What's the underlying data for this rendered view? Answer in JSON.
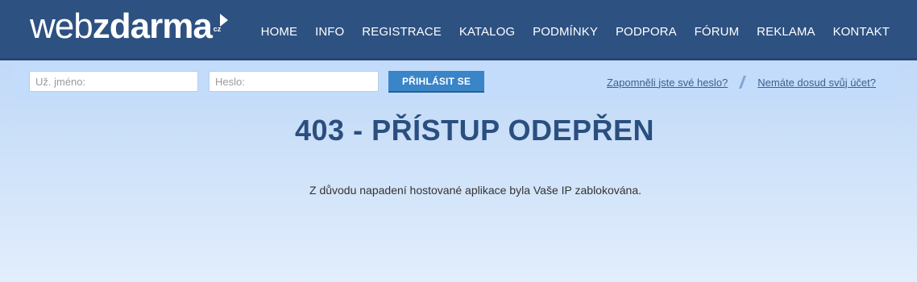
{
  "logo": {
    "web": "web",
    "zdarma": "zdarma",
    "cz": "cz"
  },
  "nav": {
    "home": "HOME",
    "info": "INFO",
    "registrace": "REGISTRACE",
    "katalog": "KATALOG",
    "podminky": "PODMÍNKY",
    "podpora": "PODPORA",
    "forum": "FÓRUM",
    "reklama": "REKLAMA",
    "kontakt": "KONTAKT"
  },
  "login": {
    "username_placeholder": "Už. jméno:",
    "password_placeholder": "Heslo:",
    "submit_label": "PŘIHLÁSIT SE",
    "forgot_link": "Zapomněli jste své heslo?",
    "no_account_link": "Nemáte dosud svůj účet?"
  },
  "main": {
    "title": "403 - PŘÍSTUP ODEPŘEN",
    "message": "Z důvodu napadení hostované aplikace byla Vaše IP zablokována."
  },
  "colors": {
    "header_bg": "#2d5181",
    "login_bar_bg": "#c3dcfb",
    "button_bg": "#3a84c8",
    "title_color": "#2a4f7f"
  }
}
